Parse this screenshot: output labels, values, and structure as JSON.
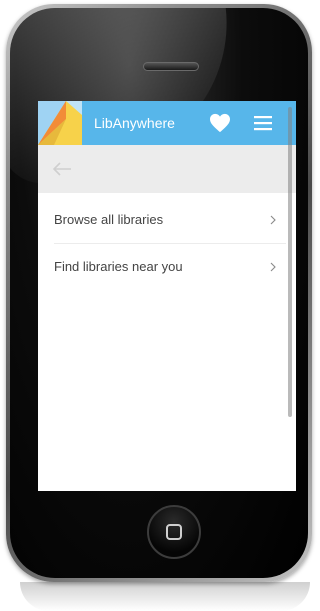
{
  "app": {
    "title": "LibAnywhere"
  },
  "header": {
    "favorites_icon": "heart-icon",
    "menu_icon": "hamburger-menu-icon"
  },
  "toolbar": {
    "back_icon": "arrow-left-icon"
  },
  "menu": {
    "items": [
      {
        "label": "Browse all libraries",
        "icon": "chevron-right-icon"
      },
      {
        "label": "Find libraries near you",
        "icon": "chevron-right-icon"
      }
    ]
  },
  "colors": {
    "header_bg": "#57b6ea",
    "toolbar_bg": "#ececec",
    "text": "#444444",
    "logo_yellow": "#f7d24a",
    "logo_orange": "#f28c38",
    "logo_blue": "#9fd3f3"
  }
}
